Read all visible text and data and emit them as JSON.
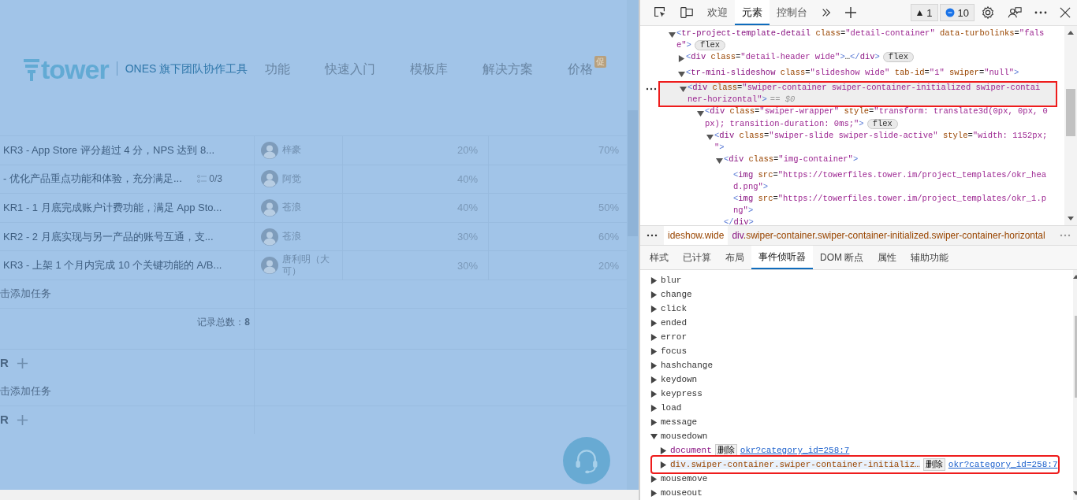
{
  "page": {
    "logo": "tower",
    "tagline": "ONES 旗下团队协作工具",
    "nav": [
      {
        "label": "功能"
      },
      {
        "label": "快速入门"
      },
      {
        "label": "模板库"
      },
      {
        "label": "解决方案"
      },
      {
        "label": "价格",
        "badge": "促"
      }
    ],
    "rows": [
      {
        "title": "KR3 - App Store 评分超过 4 分，NPS 达到 8...",
        "assignee": "梓豪",
        "column_3": "20%",
        "column_4": "70%"
      },
      {
        "title": "- 优化产品重点功能和体验，充分满足...",
        "subtasks": "0/3",
        "assignee": "阿觉",
        "column_3": "40%"
      },
      {
        "title": "KR1 - 1 月底完成账户计费功能，满足 App Sto...",
        "assignee": "苍浪",
        "column_3": "40%",
        "column_4": "50%"
      },
      {
        "title": "KR2 - 2 月底实现与另一产品的账号互通，支...",
        "assignee": "苍浪",
        "column_3": "30%",
        "column_4": "60%"
      },
      {
        "title": "KR3 - 上架 1 个月内完成 10 个关键功能的 A/B...",
        "assignee": "唐利明（大可）",
        "column_3": "30%",
        "column_4": "20%"
      }
    ],
    "blocks": [
      {
        "kind": "add_task",
        "text": "击添加任务"
      },
      {
        "kind": "count",
        "text": "记录总数：**8**"
      },
      {
        "kind": "heading",
        "text": "R"
      },
      {
        "kind": "add_task",
        "text": "击添加任务"
      },
      {
        "kind": "heading",
        "text": "R"
      }
    ]
  },
  "devtools": {
    "tabs": [
      {
        "label": "欢迎",
        "selected": false
      },
      {
        "label": "元素",
        "selected": true
      },
      {
        "label": "控制台",
        "selected": false
      }
    ],
    "warnings": "1",
    "messages": "10",
    "dom_tree": [
      {
        "lines": [
          "<tr-project-template-detail class=\"detail-container\" data-turbolinks=\"fals",
          "e\">"
        ],
        "badge": "flex",
        "expanded": true,
        "selected": false,
        "highlighted": false,
        "children": [
          {
            "lines": [
              "<div class=\"detail-header wide\">…</div>"
            ],
            "badge": "flex",
            "expanded": false,
            "selected": false,
            "highlighted": false
          },
          {
            "lines": [
              "<tr-mini-slideshow class=\"slideshow wide\" tab-id=\"1\" swiper=\"null\">"
            ],
            "expanded": true,
            "selected": false,
            "highlighted": false,
            "children": [
              {
                "lines": [
                  "<div class=\"swiper-container swiper-container-initialized swiper-contai",
                  "ner-horizontal\">"
                ],
                "suffix": "== $0",
                "expanded": true,
                "selected": true,
                "highlighted": true,
                "children": [
                  {
                    "lines": [
                      "<div class=\"swiper-wrapper\" style=\"transform: translate3d(0px, 0px, 0",
                      "px); transition-duration: 0ms;\">"
                    ],
                    "badge": "flex",
                    "expanded": true,
                    "selected": false,
                    "highlighted": false,
                    "children": [
                      {
                        "lines": [
                          "<div class=\"swiper-slide swiper-slide-active\" style=\"width: 1152px;",
                          "\">"
                        ],
                        "expanded": true,
                        "selected": false,
                        "highlighted": false,
                        "children": [
                          {
                            "lines": [
                              "<div class=\"img-container\">"
                            ],
                            "closing": "</div>",
                            "expanded": true,
                            "selected": false,
                            "highlighted": false,
                            "children": [
                              {
                                "lines": [
                                  "<img src=\"https://towerfiles.tower.im/project_templates/okr_hea",
                                  "d.png\">"
                                ],
                                "selected": false,
                                "highlighted": false
                              },
                              {
                                "lines": [
                                  "<img src=\"https://towerfiles.tower.im/project_templates/okr_1.p",
                                  "ng\">"
                                ],
                                "selected": false,
                                "highlighted": false
                              }
                            ]
                          }
                        ]
                      }
                    ]
                  }
                ]
              }
            ]
          }
        ]
      }
    ],
    "breadcrumbs": [
      {
        "classes": "ideshow.wide",
        "selected": false
      },
      {
        "tag": "div",
        "classes": ".swiper-container.swiper-container-initialized.swiper-container-horizontal",
        "selected": true
      }
    ],
    "panel_tabs": [
      {
        "label": "样式",
        "selected": false
      },
      {
        "label": "已计算",
        "selected": false
      },
      {
        "label": "布局",
        "selected": false
      },
      {
        "label": "事件侦听器",
        "selected": true
      },
      {
        "label": "DOM 断点",
        "selected": false
      },
      {
        "label": "属性",
        "selected": false
      },
      {
        "label": "辅助功能",
        "selected": false
      }
    ],
    "listeners": [
      {
        "name": "blur",
        "expanded": false
      },
      {
        "name": "change",
        "expanded": false
      },
      {
        "name": "click",
        "expanded": false
      },
      {
        "name": "ended",
        "expanded": false
      },
      {
        "name": "error",
        "expanded": false
      },
      {
        "name": "focus",
        "expanded": false
      },
      {
        "name": "hashchange",
        "expanded": false
      },
      {
        "name": "keydown",
        "expanded": false
      },
      {
        "name": "keypress",
        "expanded": false
      },
      {
        "name": "load",
        "expanded": false
      },
      {
        "name": "message",
        "expanded": false
      },
      {
        "name": "mousedown",
        "expanded": true,
        "children": [
          {
            "target": "document",
            "action": "删除",
            "source": "okr?category_id=258:7",
            "expanded": false,
            "highlighted": false
          },
          {
            "target": "div.swiper-container.swiper-container-initializ…",
            "action": "删除",
            "source": "okr?category_id=258:7",
            "expanded": false,
            "highlighted": true
          }
        ]
      },
      {
        "name": "mousemove",
        "expanded": false
      },
      {
        "name": "mouseout",
        "expanded": false
      }
    ]
  }
}
